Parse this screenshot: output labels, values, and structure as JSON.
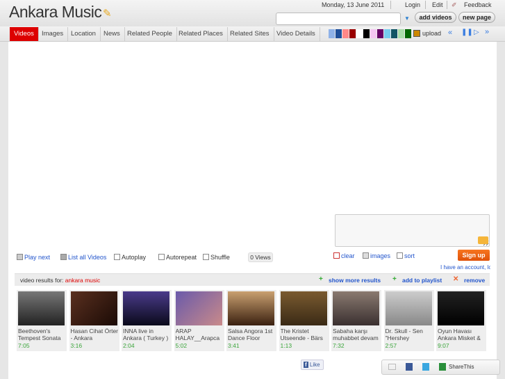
{
  "header": {
    "title": "Ankara Music",
    "date": "Monday, 13 June 2011",
    "login": "Login",
    "edit": "Edit",
    "feedback": "Feedback",
    "search_value": "",
    "add_videos": "add videos",
    "new_page": "new page"
  },
  "tabs": [
    {
      "label": "Videos",
      "active": true
    },
    {
      "label": "Images"
    },
    {
      "label": "Location"
    },
    {
      "label": "News"
    },
    {
      "label": "Related People"
    },
    {
      "label": "Related Places"
    },
    {
      "label": "Related Sites"
    },
    {
      "label": "Video Details"
    }
  ],
  "swatches": [
    "#8fb2e8",
    "#1f4f99",
    "#ff8888",
    "#990000",
    "#ffffff",
    "#000000",
    "#f5c6f2",
    "#660066",
    "#77ccee",
    "#115566",
    "#aaddaa",
    "#006600"
  ],
  "upload": "upload",
  "controls": {
    "play_next": "Play next",
    "list_all": "List all Videos",
    "autoplay": "Autoplay",
    "autorepeat": "Autorepeat",
    "shuffle": "Shuffle",
    "views": "0 Views",
    "clear": "clear",
    "images": "images",
    "sort": "sort",
    "signup": "Sign up",
    "account": "I have an account, lo"
  },
  "results": {
    "label": "video results for:",
    "query": "ankara music",
    "show_more": "show more results",
    "add_playlist": "add to playlist",
    "remove": "remove"
  },
  "videos": [
    {
      "title": "Beethoven's Tempest Sonata",
      "duration": "7:05"
    },
    {
      "title": "Hasan Cihat Örter - Ankara",
      "duration": "3:16"
    },
    {
      "title": "INNA live in Ankara ( Turkey )",
      "duration": "2:04"
    },
    {
      "title": "ARAP HALAY__Arapca",
      "duration": "5:02"
    },
    {
      "title": "Salsa Angora 1st Dance Floor",
      "duration": "3:41"
    },
    {
      "title": "The Kristet Utseende - Bärs",
      "duration": "1:13"
    },
    {
      "title": "Sabaha karşı muhabbet devam",
      "duration": "7:32"
    },
    {
      "title": "Dr. Skull - Sen \"Hershey",
      "duration": "2:57"
    },
    {
      "title": "Oyun Havası Ankara Misket &",
      "duration": "9:07"
    }
  ],
  "footer": {
    "like": "Like",
    "sharethis": "ShareThis"
  }
}
